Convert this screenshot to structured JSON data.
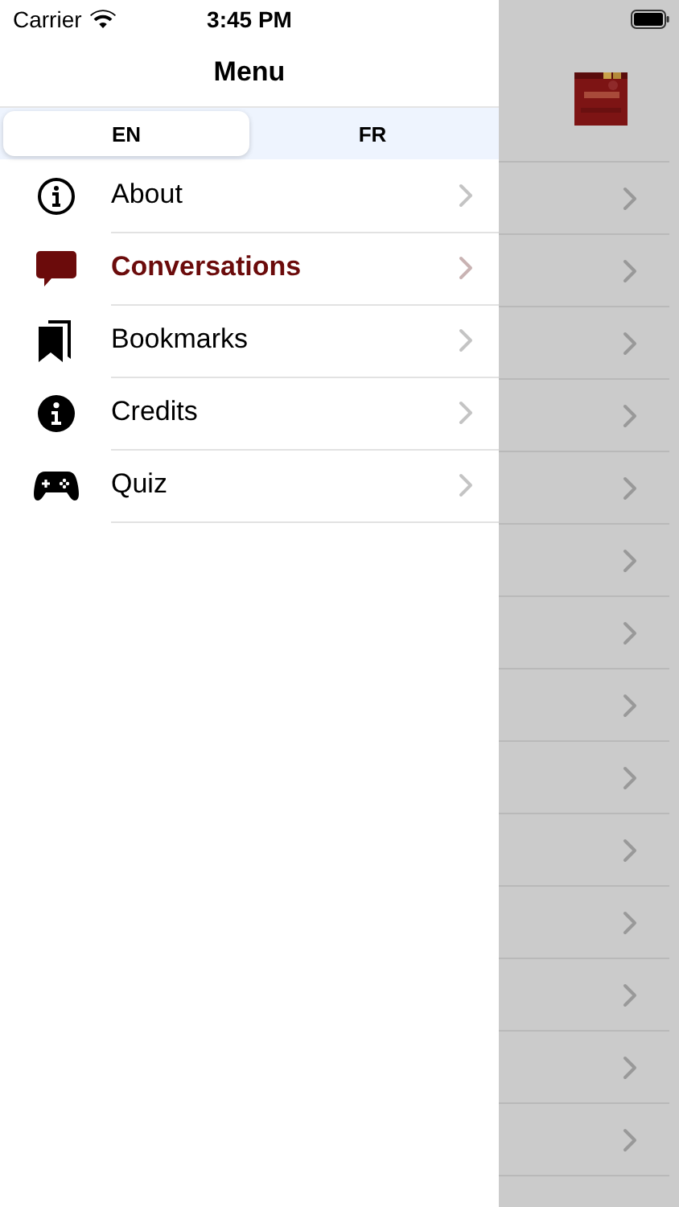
{
  "status_bar": {
    "carrier": "Carrier",
    "time": "3:45 PM"
  },
  "nav_bar": {
    "title": "Menu"
  },
  "language_segments": [
    {
      "label": "EN",
      "selected": true
    },
    {
      "label": "FR",
      "selected": false
    }
  ],
  "menu_items": [
    {
      "label": "About",
      "selected": false
    },
    {
      "label": "Conversations",
      "selected": true
    },
    {
      "label": "Bookmarks",
      "selected": false
    },
    {
      "label": "Credits",
      "selected": false
    },
    {
      "label": "Quiz",
      "selected": false
    }
  ]
}
